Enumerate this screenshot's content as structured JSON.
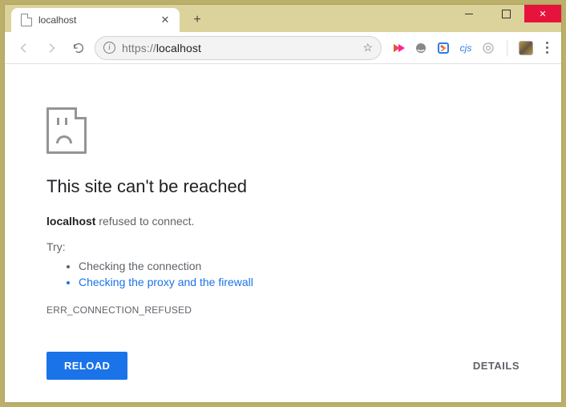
{
  "tab": {
    "title": "localhost"
  },
  "address": {
    "scheme": "https://",
    "host": "localhost"
  },
  "extensions": {
    "cjs_label": "cjs"
  },
  "error": {
    "heading": "This site can't be reached",
    "host": "localhost",
    "refused_text": " refused to connect.",
    "try_label": "Try:",
    "tips": {
      "0": "Checking the connection",
      "1": "Checking the proxy and the firewall"
    },
    "code": "ERR_CONNECTION_REFUSED"
  },
  "buttons": {
    "reload": "RELOAD",
    "details": "DETAILS"
  }
}
